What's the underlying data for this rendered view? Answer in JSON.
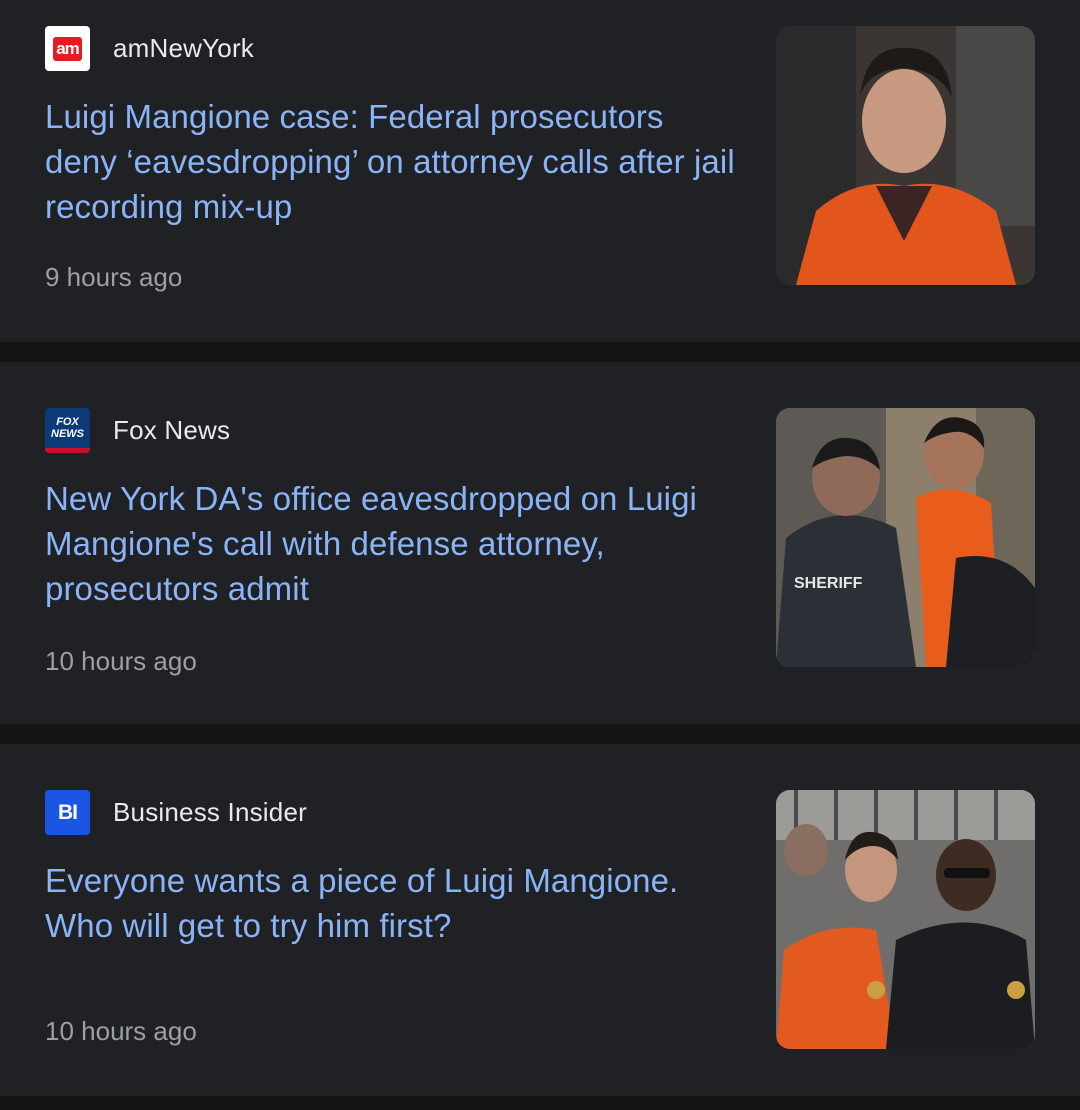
{
  "articles": [
    {
      "source": "amNewYork",
      "logo_text": "am",
      "headline": "Luigi Mangione case: Federal prosecutors deny ‘eavesdropping’ on attorney calls after jail recording mix-up",
      "time": "9 hours ago"
    },
    {
      "source": "Fox News",
      "logo_text_top": "FOX",
      "logo_text_bottom": "NEWS",
      "headline": "New York DA's office eavesdropped on Luigi Mangione's call with defense attorney, prosecutors admit",
      "time": "10 hours ago",
      "thumb_text": "SHERIFF"
    },
    {
      "source": "Business Insider",
      "logo_text": "BI",
      "headline": "Everyone wants a piece of Luigi Mangione. Who will get to try him first?",
      "time": "10 hours ago"
    }
  ],
  "colors": {
    "background": "#202124",
    "separator": "#151516",
    "headline": "#8ab4f8",
    "source": "#e8eaed",
    "time": "#9aa0a6"
  }
}
